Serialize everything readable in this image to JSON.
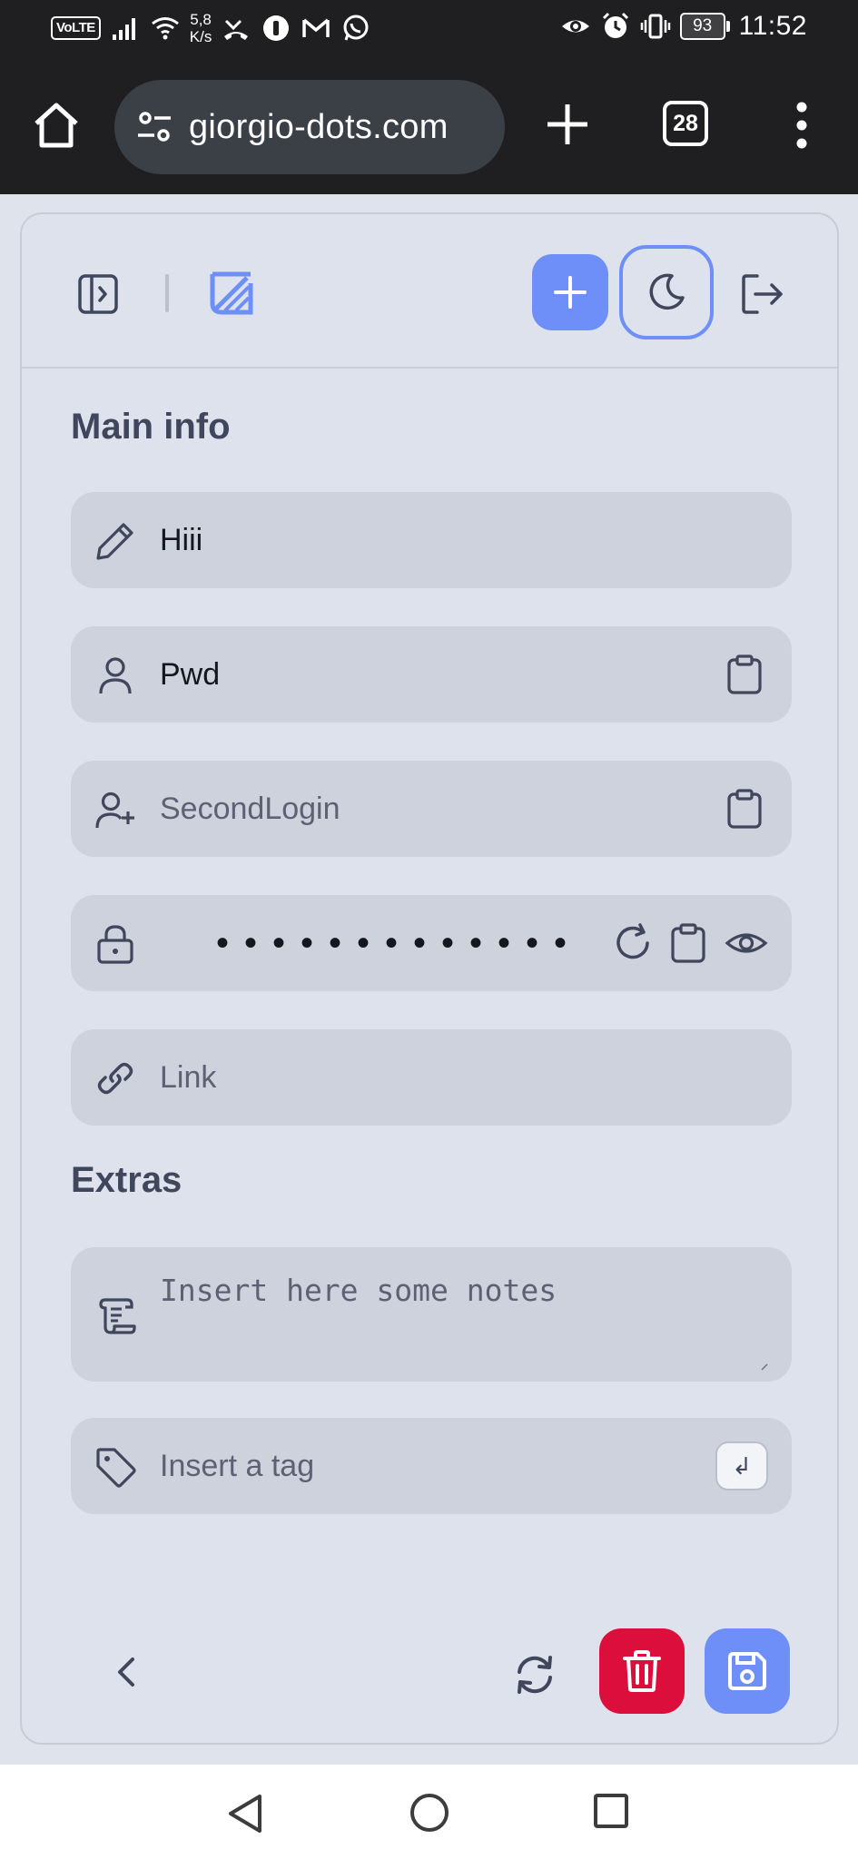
{
  "status_bar": {
    "network_badge": "VoLTE",
    "speed_value": "5,8",
    "speed_unit": "K/s",
    "battery": "93",
    "time": "11:52"
  },
  "browser": {
    "url": "giorgio-dots.com",
    "tab_count": "28"
  },
  "main_info": {
    "title": "Main info",
    "name_value": "Hiii",
    "username_value": "Pwd",
    "second_login_placeholder": "SecondLogin",
    "password_mask": "•••••••••••••",
    "link_placeholder": "Link"
  },
  "extras": {
    "title": "Extras",
    "notes_placeholder": "Insert here some notes",
    "tag_placeholder": "Insert a tag",
    "tag_enter_key": "↲"
  },
  "colors": {
    "accent": "#6e8ff7",
    "danger": "#dc0f3c",
    "field_bg": "#cdd2dd",
    "card_bg": "#dee2ec",
    "text_dark": "#40465b"
  },
  "icons": {
    "header": [
      "sidebar-toggle-icon",
      "app-logo-icon",
      "plus-icon",
      "moon-icon",
      "logout-icon"
    ],
    "fields": [
      "pencil-icon",
      "user-icon",
      "user-plus-icon",
      "lock-icon",
      "link-icon",
      "scroll-icon",
      "tag-icon"
    ],
    "footer": [
      "chevron-left-icon",
      "sync-icon",
      "trash-icon",
      "floppy-disk-icon"
    ]
  }
}
